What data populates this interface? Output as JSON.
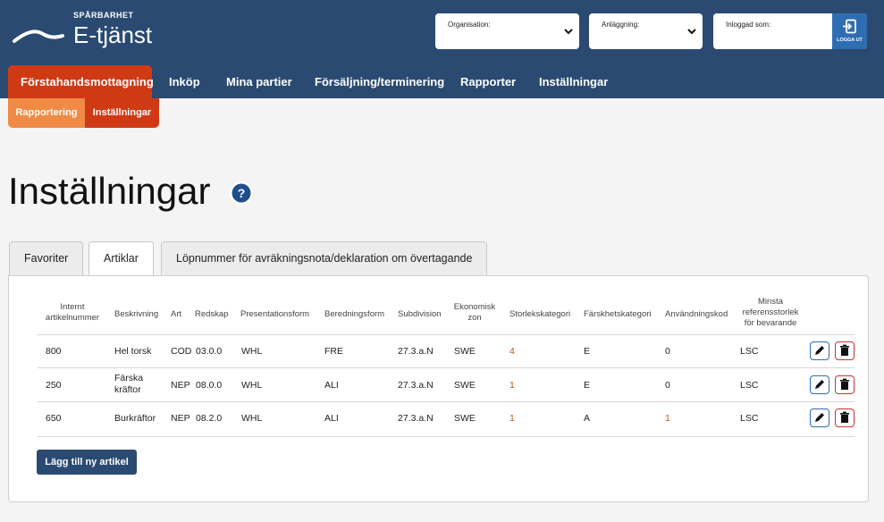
{
  "header": {
    "logo_small": "SPÅRBARHET",
    "logo_big": "E-tjänst",
    "org_label": "Organisation:",
    "anl_label": "Anläggning:",
    "user_label": "Inloggad som:",
    "logout_label": "LOGGA UT"
  },
  "nav": {
    "items": [
      "Förstahandsmottagning",
      "Inköp",
      "Mina partier",
      "Försäljning/terminering",
      "Rapporter",
      "Inställningar"
    ],
    "active_index": 0
  },
  "subnav": {
    "items": [
      "Rapportering",
      "Inställningar"
    ]
  },
  "page": {
    "title": "Inställningar"
  },
  "tabs": {
    "items": [
      "Favoriter",
      "Artiklar",
      "Löpnummer för avräkningsnota/deklaration om övertagande"
    ],
    "active_index": 1
  },
  "table": {
    "headers": [
      "Internt artikelnummer",
      "Beskrivning",
      "Art",
      "Redskap",
      "Presentationsform",
      "Beredningsform",
      "Subdivision",
      "Ekonomisk zon",
      "Storlekskategori",
      "Färskhetskategori",
      "Användningskod",
      "Minsta referensstorlek för bevarande"
    ],
    "rows": [
      [
        "800",
        "Hel torsk",
        "COD",
        "03.0.0",
        "WHL",
        "FRE",
        "27.3.a.N",
        "SWE",
        "4",
        "E",
        "0",
        "LSC"
      ],
      [
        "250",
        "Färska kräftor",
        "NEP",
        "08.0.0",
        "WHL",
        "ALI",
        "27.3.a.N",
        "SWE",
        "1",
        "E",
        "0",
        "LSC"
      ],
      [
        "650",
        "Burkräftor",
        "NEP",
        "08.2.0",
        "WHL",
        "ALI",
        "27.3.a.N",
        "SWE",
        "1",
        "A",
        "1",
        "LSC"
      ]
    ]
  },
  "actions": {
    "add_label": "Lägg till ny artikel"
  },
  "colors": {
    "header_bg": "#2a4a72",
    "nav_active": "#cf3a14",
    "subnav_first": "#f08a45",
    "edit_border": "#2f6db3",
    "delete_border": "#d03030"
  }
}
